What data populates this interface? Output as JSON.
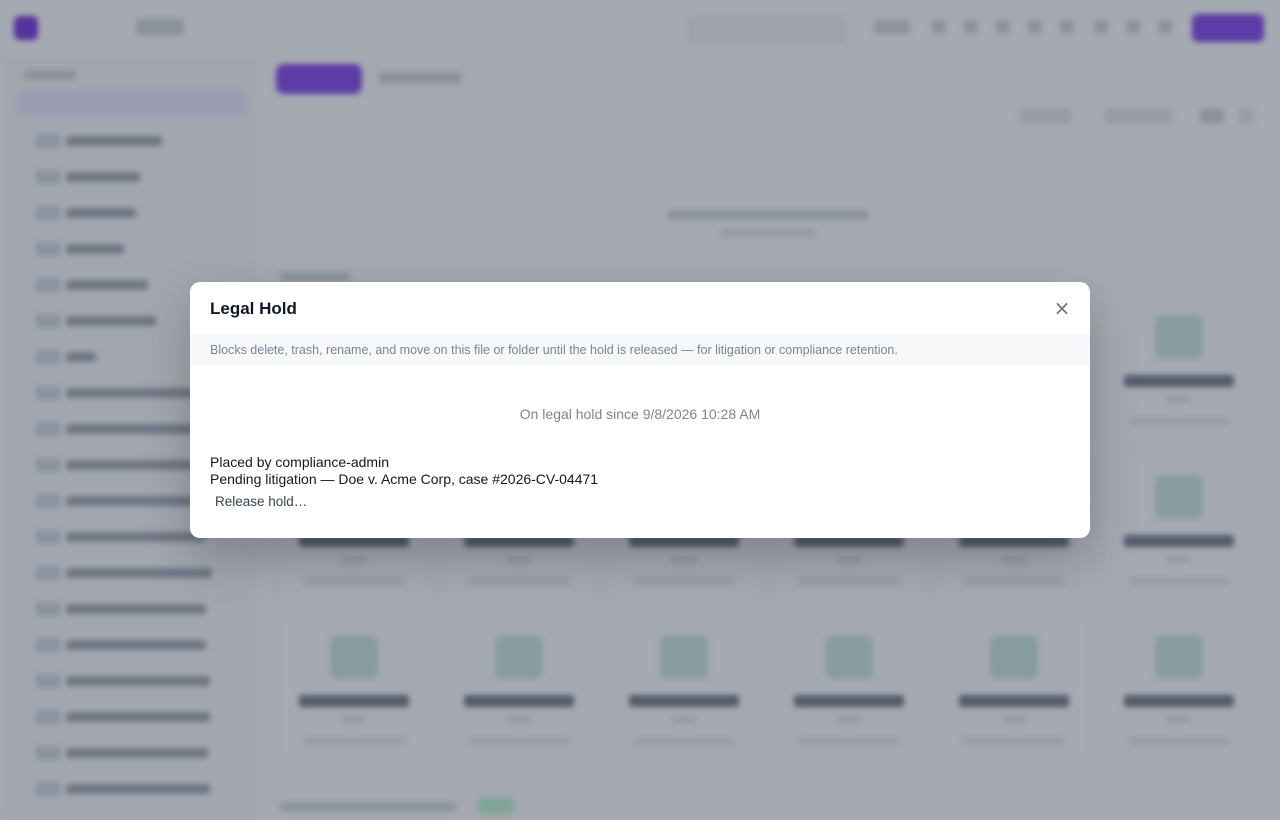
{
  "modal": {
    "title": "Legal Hold",
    "close_glyph": "×",
    "close_icon": "close-icon",
    "description": "Blocks delete, trash, rename, and move on this file or folder until the hold is released — for litigation or compliance retention.",
    "status_text": "On legal hold since 9/8/2026 10:28 AM",
    "placed_by": "Placed by compliance-admin",
    "reason": "Pending litigation — Doe v. Acme Corp, case #2026-CV-04471",
    "release_label": "Release hold…"
  },
  "colors": {
    "accent": "#7c3aed",
    "overlay": "rgba(55,65,81,0.45)",
    "muted_text": "#7b8494"
  }
}
